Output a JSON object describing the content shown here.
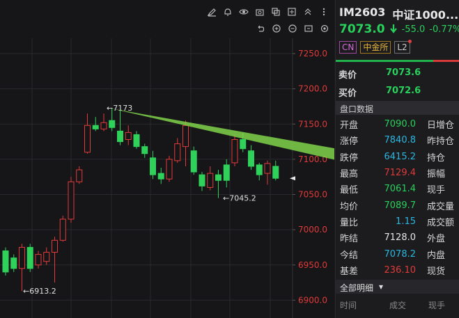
{
  "toolbar_top": [
    "draw-icon",
    "bell-icon",
    "eye-icon",
    "camera-icon",
    "copy-icon",
    "layers-icon",
    "chevron-up-icon",
    "more-icon"
  ],
  "toolbar_second": [
    "undo-icon",
    "zoom-in-icon",
    "zoom-out-icon",
    "fit-icon",
    "settings-icon"
  ],
  "header": {
    "code": "IM2603",
    "name": "中证1000..."
  },
  "price": {
    "last": "7073.0",
    "change": "-55.0",
    "change_pct": "-0.77%"
  },
  "tags": {
    "cn": "CN",
    "exchange": "中金所",
    "level": "L2"
  },
  "quote": {
    "ask_label": "卖价",
    "ask": "7073.6",
    "bid_label": "买价",
    "bid": "7072.6"
  },
  "section_title": "盘口数据",
  "stats": [
    {
      "k": "开盘",
      "v": "7090.0",
      "c": "c-green",
      "k2": "日增仓"
    },
    {
      "k": "涨停",
      "v": "7840.8",
      "c": "c-blue",
      "k2": "昨持仓"
    },
    {
      "k": "跌停",
      "v": "6415.2",
      "c": "c-blue",
      "k2": "持仓"
    },
    {
      "k": "最高",
      "v": "7129.4",
      "c": "c-red",
      "k2": "振幅"
    },
    {
      "k": "最低",
      "v": "7061.4",
      "c": "c-green",
      "k2": "现手"
    },
    {
      "k": "均价",
      "v": "7089.7",
      "c": "c-green",
      "k2": "成交量"
    },
    {
      "k": "量比",
      "v": "1.15",
      "c": "c-blue",
      "k2": "成交额"
    },
    {
      "k": "昨结",
      "v": "7128.0",
      "c": "c-white",
      "k2": "外盘"
    },
    {
      "k": "今结",
      "v": "7078.2",
      "c": "c-blue",
      "k2": "内盘"
    },
    {
      "k": "基差",
      "v": "236.10",
      "c": "c-red",
      "k2": "现货"
    }
  ],
  "detail": {
    "label": "全部明细",
    "cols": [
      "时间",
      "成交",
      "现手"
    ]
  },
  "chart_data": {
    "type": "candlestick",
    "ylim": [
      6895,
      7260
    ],
    "y_ticks": [
      "7250.0",
      "7200.0",
      "7150.0",
      "7100.0",
      "7050.0",
      "7000.0",
      "6950.0",
      "6900.0"
    ],
    "annotations": {
      "high": "7173",
      "low": "6913.2",
      "mid_low": "7045.2"
    },
    "candles": [
      {
        "o": 6970,
        "c": 6940,
        "h": 6975,
        "l": 6935
      },
      {
        "o": 6960,
        "c": 6945,
        "h": 6965,
        "l": 6940
      },
      {
        "o": 6945,
        "c": 6975,
        "h": 6980,
        "l": 6913
      },
      {
        "o": 6975,
        "c": 6945,
        "h": 6980,
        "l": 6940
      },
      {
        "o": 6950,
        "c": 6965,
        "h": 6970,
        "l": 6945
      },
      {
        "o": 6955,
        "c": 6968,
        "h": 6975,
        "l": 6950
      },
      {
        "o": 6968,
        "c": 6985,
        "h": 6990,
        "l": 6925
      },
      {
        "o": 6985,
        "c": 7015,
        "h": 7020,
        "l": 6983
      },
      {
        "o": 7015,
        "c": 7068,
        "h": 7075,
        "l": 7010
      },
      {
        "o": 7068,
        "c": 7085,
        "h": 7090,
        "l": 7065
      },
      {
        "o": 7110,
        "c": 7148,
        "h": 7165,
        "l": 7108
      },
      {
        "o": 7148,
        "c": 7143,
        "h": 7160,
        "l": 7140
      },
      {
        "o": 7143,
        "c": 7152,
        "h": 7165,
        "l": 7140
      },
      {
        "o": 7155,
        "c": 7145,
        "h": 7173,
        "l": 7140
      },
      {
        "o": 7140,
        "c": 7125,
        "h": 7170,
        "l": 7120
      },
      {
        "o": 7128,
        "c": 7138,
        "h": 7148,
        "l": 7120
      },
      {
        "o": 7135,
        "c": 7118,
        "h": 7140,
        "l": 7115
      },
      {
        "o": 7118,
        "c": 7108,
        "h": 7122,
        "l": 7102
      },
      {
        "o": 7102,
        "c": 7078,
        "h": 7112,
        "l": 7072
      },
      {
        "o": 7080,
        "c": 7072,
        "h": 7088,
        "l": 7065
      },
      {
        "o": 7072,
        "c": 7100,
        "h": 7105,
        "l": 7068
      },
      {
        "o": 7098,
        "c": 7122,
        "h": 7130,
        "l": 7095
      },
      {
        "o": 7118,
        "c": 7148,
        "h": 7155,
        "l": 7090
      },
      {
        "o": 7112,
        "c": 7082,
        "h": 7118,
        "l": 7078
      },
      {
        "o": 7078,
        "c": 7062,
        "h": 7082,
        "l": 7055
      },
      {
        "o": 7060,
        "c": 7080,
        "h": 7090,
        "l": 7056
      },
      {
        "o": 7078,
        "c": 7070,
        "h": 7085,
        "l": 7045
      },
      {
        "o": 7092,
        "c": 7070,
        "h": 7100,
        "l": 7060
      },
      {
        "o": 7095,
        "c": 7128,
        "h": 7135,
        "l": 7090
      },
      {
        "o": 7128,
        "c": 7115,
        "h": 7138,
        "l": 7110
      },
      {
        "o": 7112,
        "c": 7090,
        "h": 7120,
        "l": 7085
      },
      {
        "o": 7092,
        "c": 7078,
        "h": 7095,
        "l": 7070
      },
      {
        "o": 7080,
        "c": 7094,
        "h": 7098,
        "l": 7064
      },
      {
        "o": 7090,
        "c": 7073,
        "h": 7098,
        "l": 7070
      }
    ]
  }
}
